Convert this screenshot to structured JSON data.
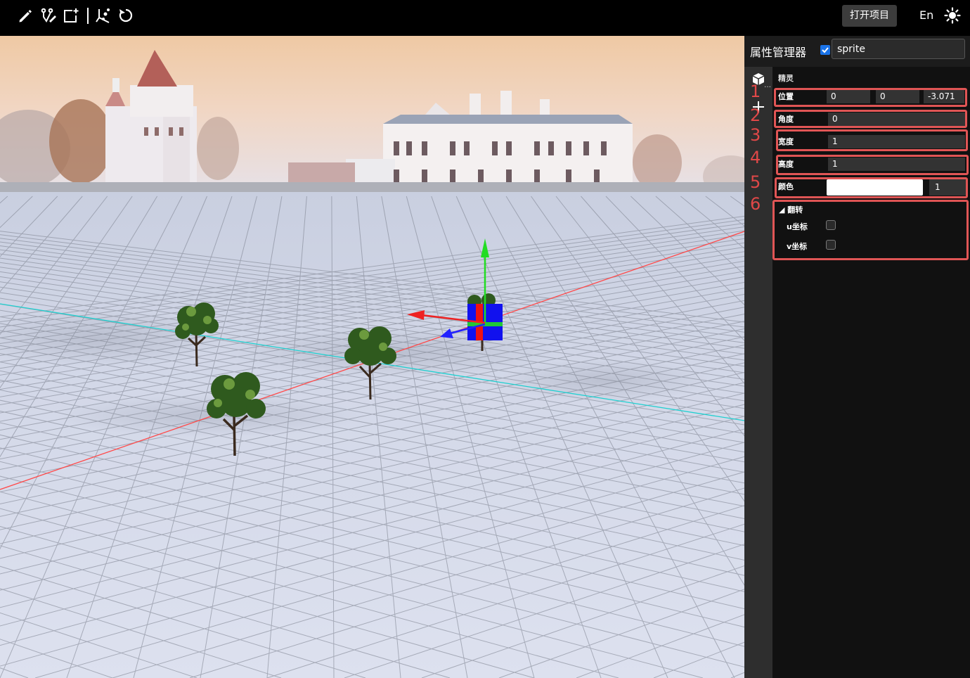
{
  "toolbar": {
    "icons": [
      "pencil-icon",
      "branch-edit-icon",
      "add-frame-icon",
      "axis-nodes-icon",
      "rotate-reset-icon"
    ],
    "open_project_label": "打开项目",
    "lang_label": "En",
    "theme_icon": "sun-icon"
  },
  "inspector": {
    "title": "属性管理器",
    "visible_checked": true,
    "object_name": "sprite",
    "section_label": "精灵",
    "markers": [
      "1",
      "2",
      "3",
      "4",
      "5",
      "6"
    ],
    "position": {
      "label": "位置",
      "x": "0",
      "y": "0",
      "z": "-3.071"
    },
    "angle": {
      "label": "角度",
      "value": "0"
    },
    "width": {
      "label": "宽度",
      "value": "1"
    },
    "height": {
      "label": "高度",
      "value": "1"
    },
    "color": {
      "label": "颜色",
      "swatch": "#ffffff",
      "alpha": "1"
    },
    "flip": {
      "title": "◢ 翻转",
      "u_label": "u坐标",
      "v_label": "v坐标",
      "u_checked": false,
      "v_checked": false
    }
  },
  "colors": {
    "highlight": "#e05555",
    "accent": "#1a73e8",
    "x_axis": "#ff3030",
    "y_axis": "#22dd22",
    "z_axis": "#2222ff"
  }
}
